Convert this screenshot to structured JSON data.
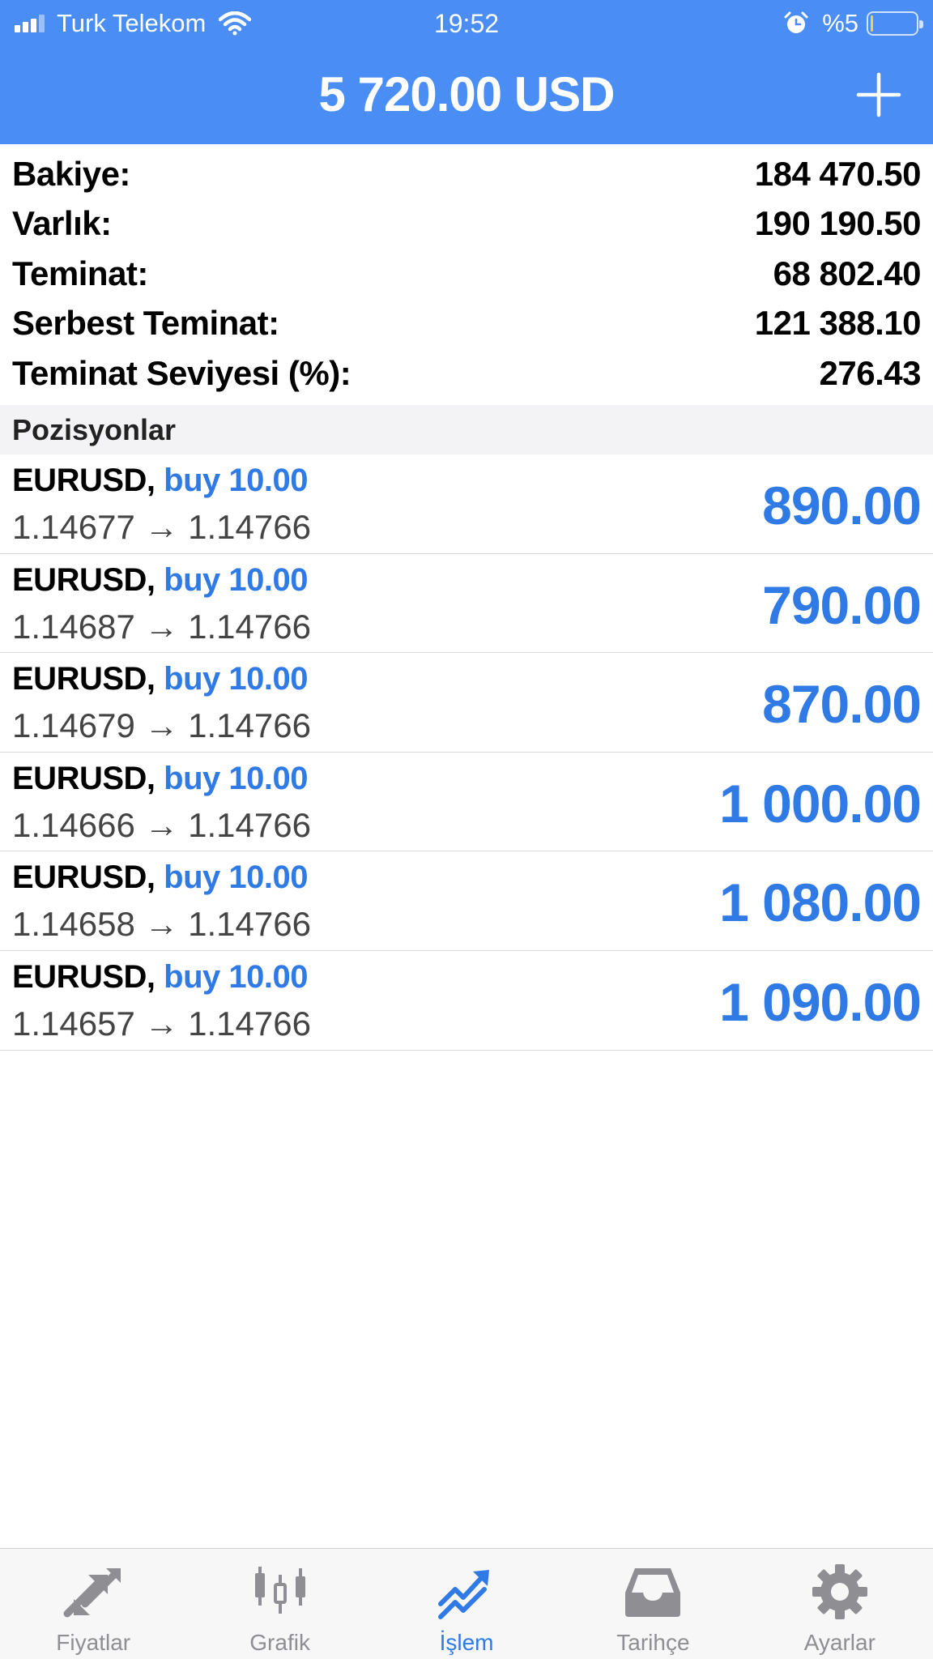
{
  "status_bar": {
    "carrier": "Turk Telekom",
    "time": "19:52",
    "battery_percent": "%5",
    "battery_level": 0.05
  },
  "header": {
    "total_profit": "5 720.00 USD",
    "add_icon": "plus-icon"
  },
  "summary": [
    {
      "label": "Bakiye:",
      "value": "184 470.50"
    },
    {
      "label": "Varlık:",
      "value": "190 190.50"
    },
    {
      "label": "Teminat:",
      "value": "68 802.40"
    },
    {
      "label": "Serbest Teminat:",
      "value": "121 388.10"
    },
    {
      "label": "Teminat Seviyesi (%):",
      "value": "276.43"
    }
  ],
  "positions_header": "Pozisyonlar",
  "positions": [
    {
      "symbol": "EURUSD,",
      "side": "buy 10.00",
      "prices": "1.14677 → 1.14766",
      "profit": "890.00"
    },
    {
      "symbol": "EURUSD,",
      "side": "buy 10.00",
      "prices": "1.14687 → 1.14766",
      "profit": "790.00"
    },
    {
      "symbol": "EURUSD,",
      "side": "buy 10.00",
      "prices": "1.14679 → 1.14766",
      "profit": "870.00"
    },
    {
      "symbol": "EURUSD,",
      "side": "buy 10.00",
      "prices": "1.14666 → 1.14766",
      "profit": "1 000.00"
    },
    {
      "symbol": "EURUSD,",
      "side": "buy 10.00",
      "prices": "1.14658 → 1.14766",
      "profit": "1 080.00"
    },
    {
      "symbol": "EURUSD,",
      "side": "buy 10.00",
      "prices": "1.14657 → 1.14766",
      "profit": "1 090.00"
    }
  ],
  "tabs": [
    {
      "label": "Fiyatlar",
      "icon": "quotes-arrows-icon",
      "active": false
    },
    {
      "label": "Grafik",
      "icon": "candlestick-chart-icon",
      "active": false
    },
    {
      "label": "İşlem",
      "icon": "trade-trend-icon",
      "active": true
    },
    {
      "label": "Tarihçe",
      "icon": "history-inbox-icon",
      "active": false
    },
    {
      "label": "Ayarlar",
      "icon": "gear-icon",
      "active": false
    }
  ],
  "colors": {
    "header_blue": "#4a8df4",
    "accent_blue": "#2f7ae5",
    "inactive_gray": "#8e8e93"
  }
}
